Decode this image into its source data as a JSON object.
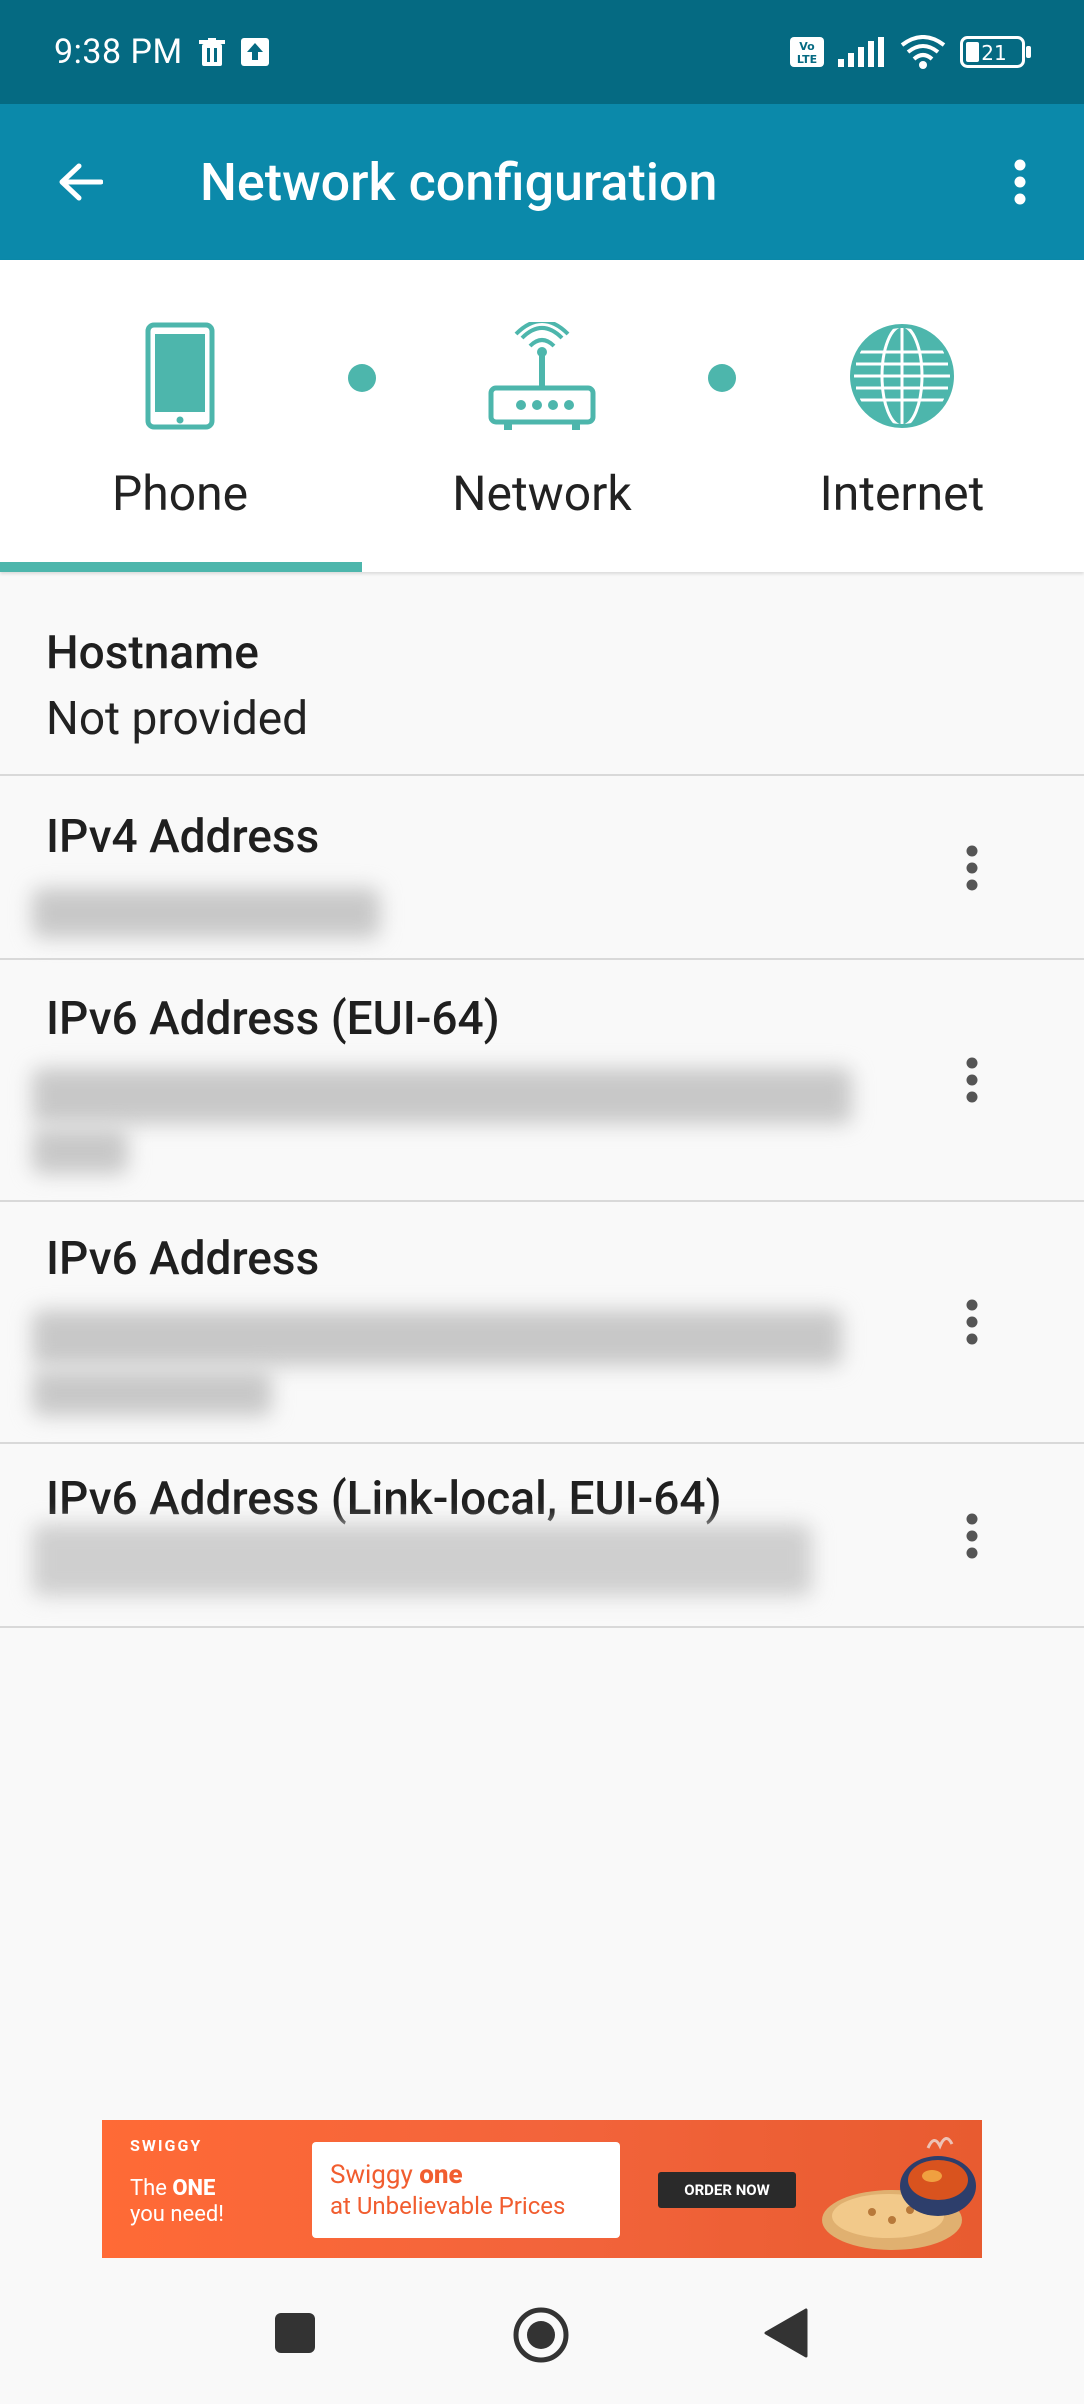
{
  "status_bar": {
    "time": "9:38 PM",
    "left_icons": [
      "trash-icon",
      "upload-icon"
    ],
    "right_icons": [
      "volte-icon",
      "signal-icon",
      "wifi-icon",
      "battery-icon"
    ],
    "volte_label": "Vo LTE",
    "battery_level": "21"
  },
  "app_bar": {
    "title": "Network configuration",
    "back_icon": "arrow-left-icon",
    "menu_icon": "more-vertical-icon"
  },
  "tabs": [
    {
      "label": "Phone",
      "icon": "phone-icon",
      "selected": true
    },
    {
      "label": "Network",
      "icon": "router-icon",
      "selected": false
    },
    {
      "label": "Internet",
      "icon": "globe-icon",
      "selected": false
    }
  ],
  "rows": [
    {
      "label": "Hostname",
      "value": "Not provided"
    },
    {
      "label": "IPv4 Address"
    },
    {
      "label": "IPv6 Address (EUI-64)"
    },
    {
      "label": "IPv6 Address"
    },
    {
      "label": "IPv6 Address (Link-local, EUI-64)"
    }
  ],
  "ad": {
    "brand": "SWIGGY",
    "tagline_1": "The ",
    "tagline_bold": "ONE",
    "tagline_2": "you need!",
    "card_line1_a": "Swiggy ",
    "card_line1_b": "one",
    "card_line2": "at Unbelievable Prices",
    "cta": "ORDER NOW"
  },
  "nav_bar": {
    "buttons": [
      "recents-icon",
      "home-icon",
      "back-icon"
    ]
  },
  "colors": {
    "status_bar": "#056a82",
    "app_bar": "#0b89aa",
    "accent": "#4db6ac",
    "background": "#f9f9f9"
  }
}
